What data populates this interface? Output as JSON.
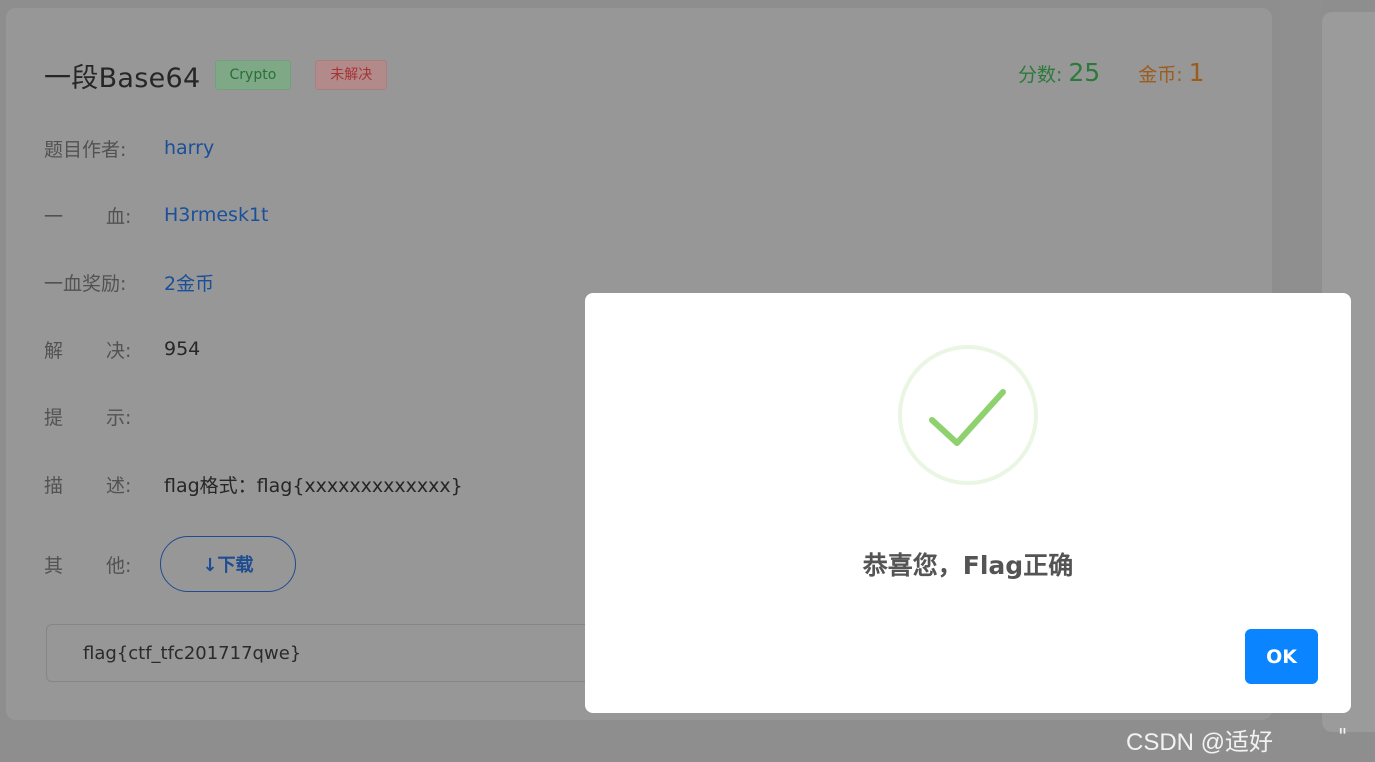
{
  "challenge": {
    "title": "一段Base64",
    "category_tag": "Crypto",
    "status_tag": "未解决",
    "score_label": "分数:",
    "score_value": "25",
    "coin_label": "金币:",
    "coin_value": "1"
  },
  "details": {
    "author_label": "题目作者:",
    "author_value": "harry",
    "first_blood_label_a": "一",
    "first_blood_label_b": "血:",
    "first_blood_value": "H3rmesk1t",
    "blood_reward_label": "一血奖励:",
    "blood_reward_value": "2金币",
    "solves_label_a": "解",
    "solves_label_b": "决:",
    "solves_value": "954",
    "hint_label_a": "提",
    "hint_label_b": "示:",
    "hint_value": "",
    "desc_label_a": "描",
    "desc_label_b": "述:",
    "desc_value": "flag格式：flag{xxxxxxxxxxxxx}",
    "other_label_a": "其",
    "other_label_b": "他:",
    "download_label": "↓下载"
  },
  "flag_input": {
    "value": "flag{ctf_tfc201717qwe}"
  },
  "modal": {
    "icon": "success-check-icon",
    "message": "恭喜您，Flag正确",
    "ok_label": "OK"
  },
  "watermark": {
    "text": "CSDN @适好",
    "quote": "\""
  },
  "colors": {
    "ok_button": "#0a84ff",
    "check": "#8fd16e",
    "score": "#2c7a3b",
    "coin": "#9c5c1e",
    "link": "#1a4f9a"
  }
}
